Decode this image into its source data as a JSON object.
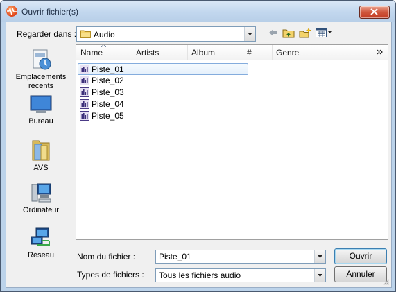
{
  "window": {
    "title": "Ouvrir fichier(s)"
  },
  "lookin": {
    "label": "Regarder dans :",
    "value": "Audio"
  },
  "toolbar": {
    "icons": [
      "back-arrow-icon",
      "up-folder-icon",
      "new-folder-icon",
      "views-menu-icon"
    ]
  },
  "places": [
    {
      "label": "Emplacements récents",
      "icon": "recent-places-icon"
    },
    {
      "label": "Bureau",
      "icon": "desktop-icon"
    },
    {
      "label": "AVS",
      "icon": "folder-avs-icon"
    },
    {
      "label": "Ordinateur",
      "icon": "computer-icon"
    },
    {
      "label": "Réseau",
      "icon": "network-icon"
    }
  ],
  "columns": [
    "Name",
    "Artists",
    "Album",
    "#",
    "Genre"
  ],
  "files": [
    "Piste_01",
    "Piste_02",
    "Piste_03",
    "Piste_04",
    "Piste_05"
  ],
  "selected_file": "Piste_01",
  "filename": {
    "label": "Nom du fichier :",
    "value": "Piste_01"
  },
  "filetype": {
    "label": "Types de fichiers :",
    "value": "Tous les fichiers audio"
  },
  "buttons": {
    "open": "Ouvrir",
    "cancel": "Annuler"
  },
  "colors": {
    "selection_border": "#84acdd",
    "selection_fill": "#e5f0fb",
    "close_button": "#c23b22"
  }
}
